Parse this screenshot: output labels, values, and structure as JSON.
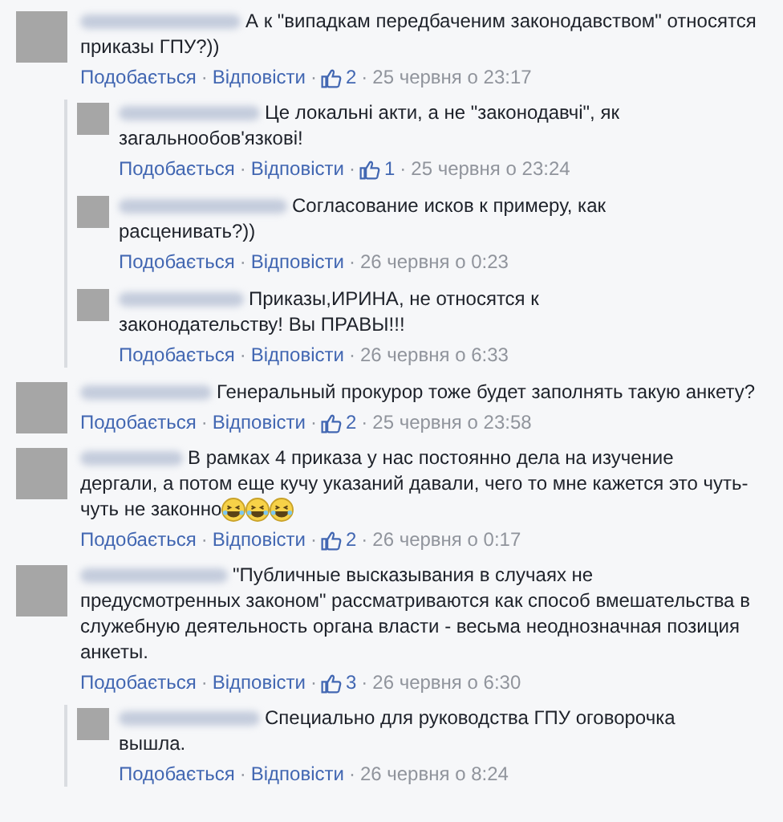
{
  "separator": "·",
  "comments": [
    {
      "lines": [
        "А к \"випадкам передбаченим законодавством\" относятся",
        "приказы ГПУ?))"
      ],
      "like": "Подобається",
      "reply": "Відповісти",
      "likes": "2",
      "time": "25 червня о 23:17",
      "replies": [
        {
          "lines": [
            "Це локальні акти, а не \"законодавчі\", як",
            "загальнообов'язкові!"
          ],
          "like": "Подобається",
          "reply": "Відповісти",
          "likes": "1",
          "time": "25 червня о 23:24"
        },
        {
          "lines": [
            "Согласование исков к примеру, как",
            "расценивать?))"
          ],
          "like": "Подобається",
          "reply": "Відповісти",
          "time": "26 червня о 0:23"
        },
        {
          "lines": [
            "Приказы,ИРИНА, не относятся к",
            "законодательству! Вы ПРАВЫ!!!"
          ],
          "like": "Подобається",
          "reply": "Відповісти",
          "time": "26 червня о 6:33"
        }
      ]
    },
    {
      "lines": [
        "Генеральный прокурор тоже будет заполнять такую анкету?"
      ],
      "like": "Подобається",
      "reply": "Відповісти",
      "likes": "2",
      "time": "25 червня о 23:58"
    },
    {
      "lines": [
        "В рамках 4 приказа у нас постоянно дела на изучение",
        "дергали, а потом еще кучу указаний давали, чего то мне кажется это чуть-",
        "чуть не законно"
      ],
      "emoji": [
        {
          "kind": "laugh"
        },
        {
          "kind": "laugh"
        },
        {
          "kind": "laugh"
        }
      ],
      "like": "Подобається",
      "reply": "Відповісти",
      "likes": "2",
      "time": "26 червня о 0:17"
    },
    {
      "lines": [
        "\"Публичные высказывания в случаях не",
        "предусмотренных законом\" рассматриваются как способ вмешательства в",
        "служебную деятельность органа власти - весьма неоднозначная позиция",
        "анкеты."
      ],
      "like": "Подобається",
      "reply": "Відповісти",
      "likes": "3",
      "time": "26 червня о 6:30",
      "replies": [
        {
          "lines": [
            "Специально для руководства ГПУ оговорочка",
            "вышла."
          ],
          "like": "Подобається",
          "reply": "Відповісти",
          "time": "26 червня о 8:24"
        }
      ]
    }
  ]
}
